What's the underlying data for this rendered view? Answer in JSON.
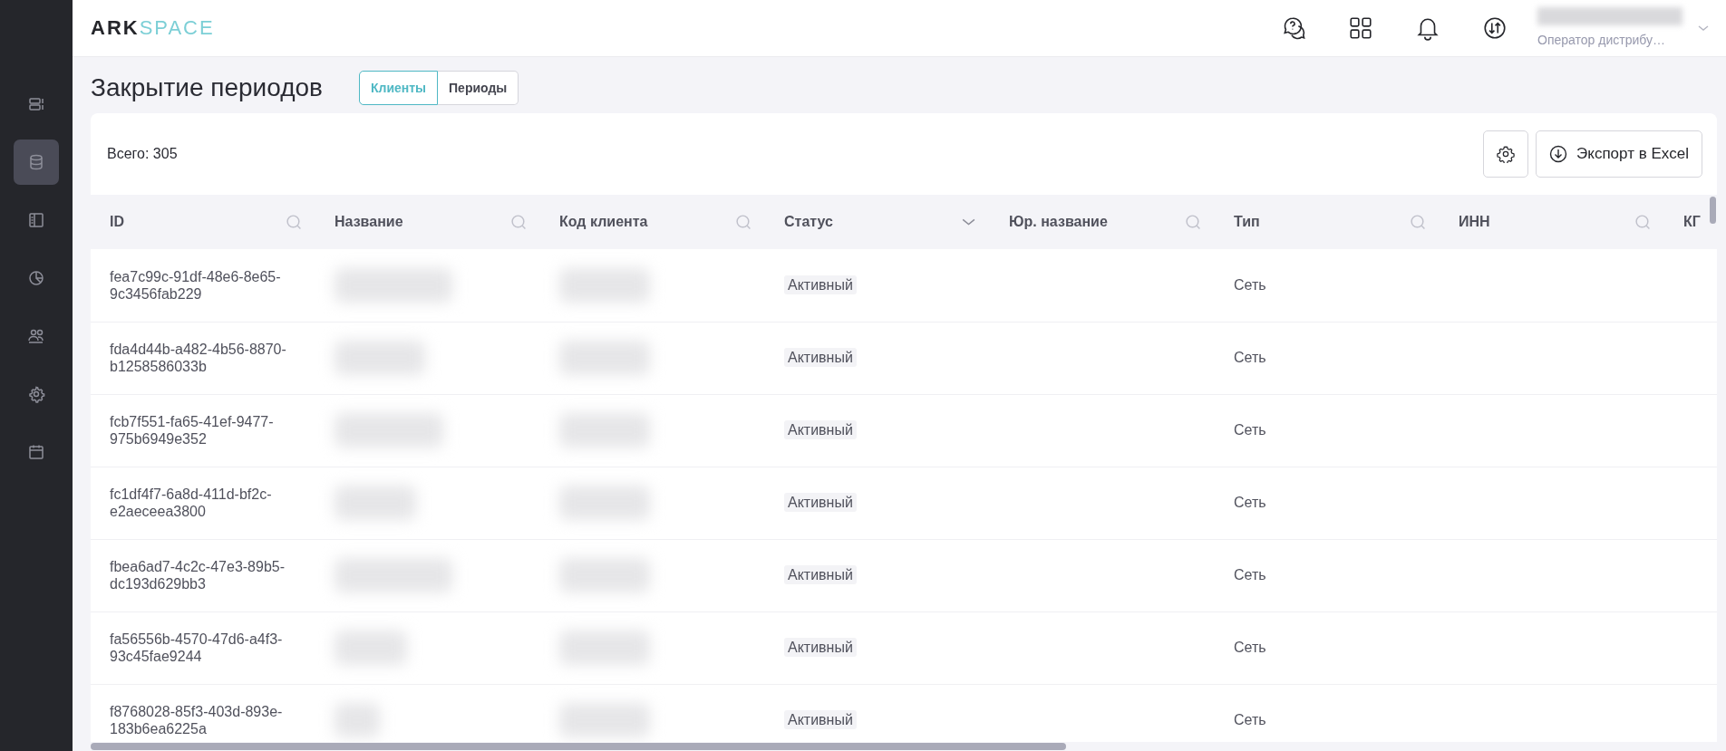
{
  "logo": {
    "part_1": "ARK",
    "part_2": "SPACE"
  },
  "header": {
    "user_role": "Оператор дистрибу…"
  },
  "sidebar": {
    "items": [
      {
        "selected": false
      },
      {
        "selected": true
      },
      {
        "selected": false
      },
      {
        "selected": false
      },
      {
        "selected": false
      },
      {
        "selected": false
      },
      {
        "selected": false
      }
    ]
  },
  "page": {
    "title": "Закрытие периодов"
  },
  "tabs": [
    {
      "label": "Клиенты",
      "selected": true
    },
    {
      "label": "Периоды",
      "selected": false
    }
  ],
  "summary": "Всего: 305",
  "buttons": {
    "export": "Экспорт в Excel"
  },
  "table": {
    "columns": [
      {
        "label": "ID",
        "kind": "search"
      },
      {
        "label": "Название",
        "kind": "search"
      },
      {
        "label": "Код клиента",
        "kind": "search"
      },
      {
        "label": "Статус",
        "kind": "dropdown"
      },
      {
        "label": "Юр. название",
        "kind": "search"
      },
      {
        "label": "Тип",
        "kind": "search"
      },
      {
        "label": "ИНН",
        "kind": "search"
      },
      {
        "label": "КГ",
        "kind": "plain"
      }
    ],
    "rows": [
      {
        "id": "fea7c99c-91df-48e6-8e65-9c3456fab229",
        "status": "Активный",
        "type": "Сеть"
      },
      {
        "id": "fda4d44b-a482-4b56-8870-b1258586033b",
        "status": "Активный",
        "type": "Сеть"
      },
      {
        "id": "fcb7f551-fa65-41ef-9477-975b6949e352",
        "status": "Активный",
        "type": "Сеть"
      },
      {
        "id": "fc1df4f7-6a8d-411d-bf2c-e2aeceea3800",
        "status": "Активный",
        "type": "Сеть"
      },
      {
        "id": "fbea6ad7-4c2c-47e3-89b5-dc193d629bb3",
        "status": "Активный",
        "type": "Сеть"
      },
      {
        "id": "fa56556b-4570-47d6-a4f3-93c45fae9244",
        "status": "Активный",
        "type": "Сеть"
      },
      {
        "id": "f8768028-85f3-403d-893e-183b6ea6225a",
        "status": "Активный",
        "type": "Сеть"
      }
    ]
  }
}
